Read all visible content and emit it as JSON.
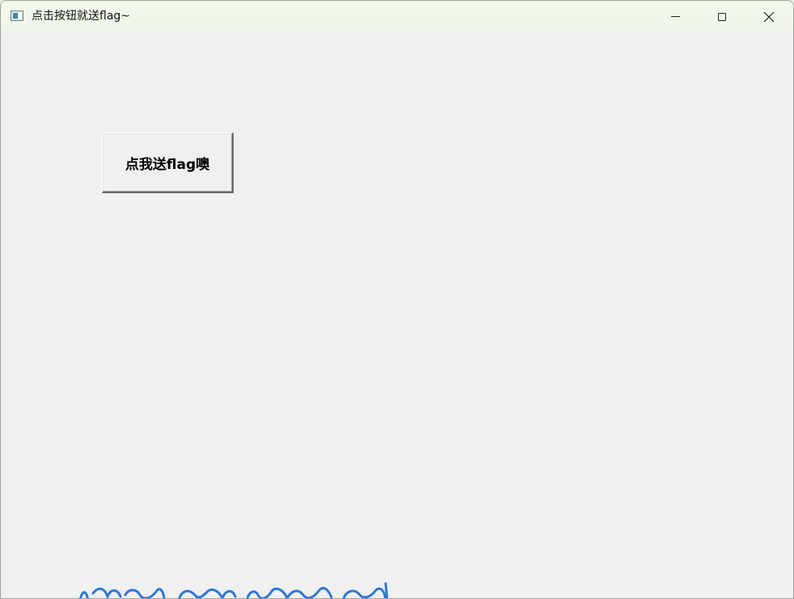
{
  "window": {
    "title": "点击按钮就送flag~"
  },
  "caption_buttons": {
    "minimize_icon": "minimize-icon",
    "maximize_icon": "maximize-icon",
    "close_icon": "close-icon"
  },
  "main": {
    "flag_button_label": "点我送flag噢"
  },
  "colors": {
    "titlebar": "#eef5e8",
    "client_bg": "#f0f0f0",
    "scribble": "#2b79d6"
  }
}
